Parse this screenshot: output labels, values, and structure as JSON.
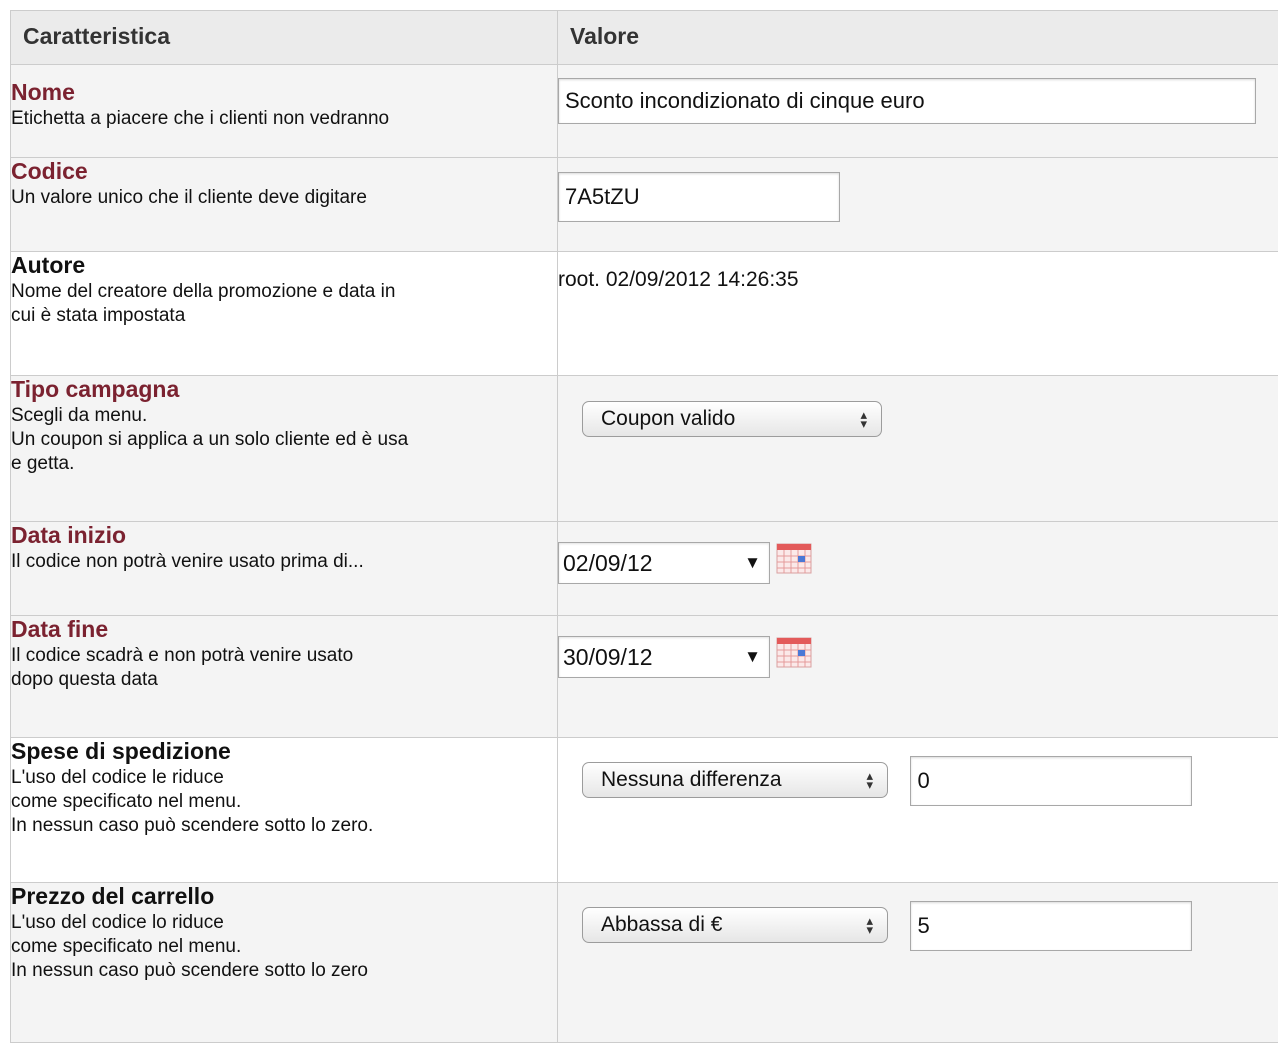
{
  "header": {
    "col1": "Caratteristica",
    "col2": "Valore"
  },
  "rows": {
    "nome": {
      "title": "Nome",
      "desc": "Etichetta a piacere che i clienti non vedranno",
      "value": "Sconto incondizionato di cinque euro"
    },
    "codice": {
      "title": "Codice",
      "desc": "Un valore unico che il cliente deve digitare",
      "value": "7A5tZU"
    },
    "autore": {
      "title": "Autore",
      "desc": "Nome del creatore della promozione e data in\ncui è stata impostata",
      "value": "root. 02/09/2012 14:26:35"
    },
    "tipo": {
      "title": "Tipo campagna",
      "desc": "Scegli da menu.\nUn coupon si applica a un solo cliente ed è usa\ne getta.",
      "selected": "Coupon valido"
    },
    "inizio": {
      "title": "Data inizio",
      "desc": "Il codice non potrà venire usato prima di...",
      "value": "02/09/12"
    },
    "fine": {
      "title": "Data fine",
      "desc": "Il codice scadrà e non potrà venire usato\ndopo questa data",
      "value": "30/09/12"
    },
    "spese": {
      "title": "Spese di spedizione",
      "desc": "L'uso del codice le riduce\ncome specificato nel menu.\nIn nessun caso può scendere sotto lo zero.",
      "selected": "Nessuna differenza",
      "value": "0"
    },
    "prezzo": {
      "title": "Prezzo del carrello",
      "desc": "L'uso del codice lo riduce\ncome specificato nel menu.\nIn nessun caso può scendere sotto lo zero",
      "selected": "Abbassa di €",
      "value": "5"
    }
  },
  "icons": {
    "date_dropdown": "triangle-down",
    "calendar": "calendar-icon",
    "select_arrows": "updown-arrows"
  },
  "colors": {
    "title_red": "#7b2230",
    "header_bg": "#ebebeb",
    "row_shade": "#f4f4f4",
    "border": "#cccccc"
  }
}
